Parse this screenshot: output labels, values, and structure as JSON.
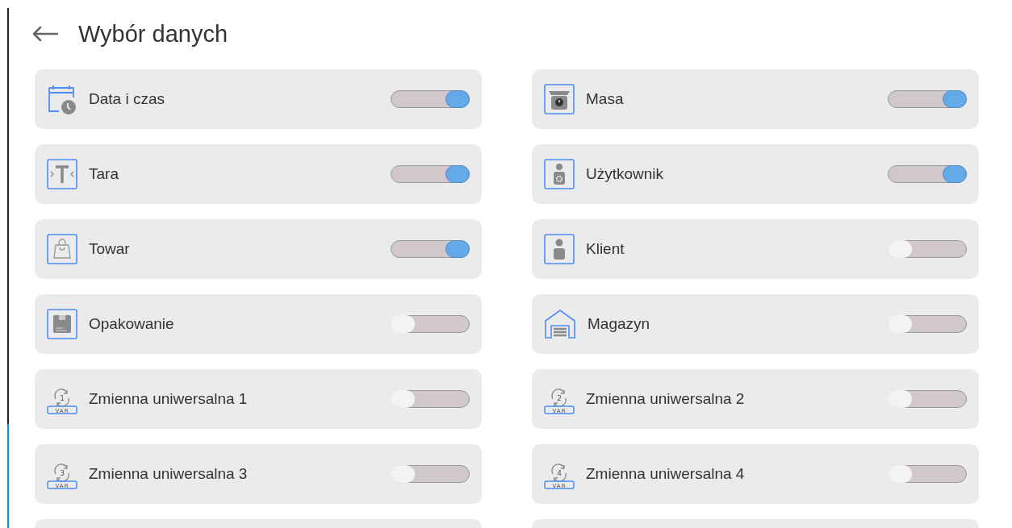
{
  "header": {
    "title": "Wybór danych"
  },
  "items": [
    {
      "label": "Data i czas",
      "kind": "calendar",
      "on": true
    },
    {
      "label": "Masa",
      "kind": "scale",
      "on": true
    },
    {
      "label": "Tara",
      "kind": "tare",
      "on": true
    },
    {
      "label": "Użytkownik",
      "kind": "user-gear",
      "on": true
    },
    {
      "label": "Towar",
      "kind": "bag",
      "on": true
    },
    {
      "label": "Klient",
      "kind": "user",
      "on": false
    },
    {
      "label": "Opakowanie",
      "kind": "package",
      "on": false
    },
    {
      "label": "Magazyn",
      "kind": "warehouse",
      "on": false
    },
    {
      "label": "Zmienna uniwersalna 1",
      "kind": "var",
      "icon_number": "1",
      "icon_label": "VAR",
      "on": false
    },
    {
      "label": "Zmienna uniwersalna 2",
      "kind": "var",
      "icon_number": "2",
      "icon_label": "VAR",
      "on": false
    },
    {
      "label": "Zmienna uniwersalna 3",
      "kind": "var",
      "icon_number": "3",
      "icon_label": "VAR",
      "on": false
    },
    {
      "label": "Zmienna uniwersalna 4",
      "kind": "var",
      "icon_number": "4",
      "icon_label": "VAR",
      "on": false
    }
  ]
}
